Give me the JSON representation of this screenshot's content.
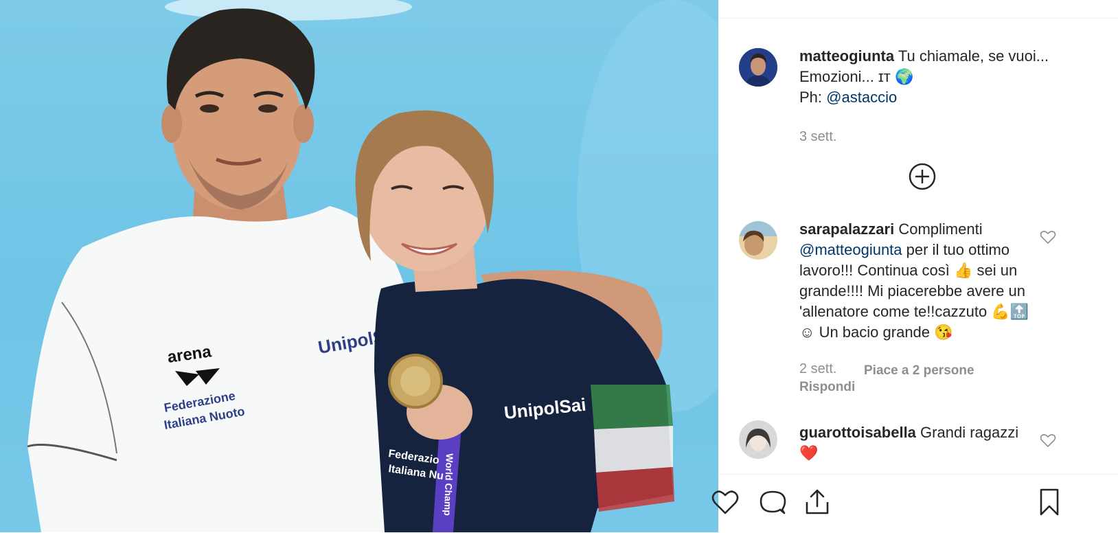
{
  "post": {
    "author": "matteogiunta",
    "caption_line1": "Tu chiamale, se vuoi...",
    "caption_line2": "Emozioni... ɪᴛ 🌍",
    "caption_ph_prefix": "Ph:",
    "caption_ph_mention": "@astaccio",
    "time": "3 sett."
  },
  "photo": {
    "shirt_left_brand": "arena",
    "shirt_left_sponsor": "UnipolSai",
    "shirt_left_line1": "Federazione",
    "shirt_left_line2": "Italiana Nuoto",
    "shirt_right_sponsor": "UnipolSai",
    "shirt_right_fed1": "Federazio",
    "shirt_right_fed2": "Italiana Nu",
    "lanyard_text": "World Champ"
  },
  "comments": [
    {
      "author": "sarapalazzari",
      "text_a": "Complimenti",
      "mention": "@matteogiunta",
      "text_b": " per il tuo ottimo",
      "line3": "lavoro!!! Continua così 👍 sei un",
      "line4": "grande!!!! Mi piacerebbe avere un",
      "line5": "'allenatore come te!!cazzuto 💪🔝",
      "line6": "☺ Un bacio grande 😘",
      "time": "2 sett.",
      "likes": "Piace a 2 persone",
      "reply": "Rispondi"
    },
    {
      "author": "guarottoisabella",
      "text": "Grandi ragazzi",
      "emoji": "❤️"
    }
  ],
  "icons": {
    "like": "heart-icon",
    "comment": "comment-icon",
    "share": "share-icon",
    "save": "bookmark-icon",
    "load_more": "plus-circle-icon"
  },
  "colors": {
    "text": "#262626",
    "muted": "#8e8e8e",
    "link": "#00376b",
    "photo_bg": "#72c5e7"
  }
}
